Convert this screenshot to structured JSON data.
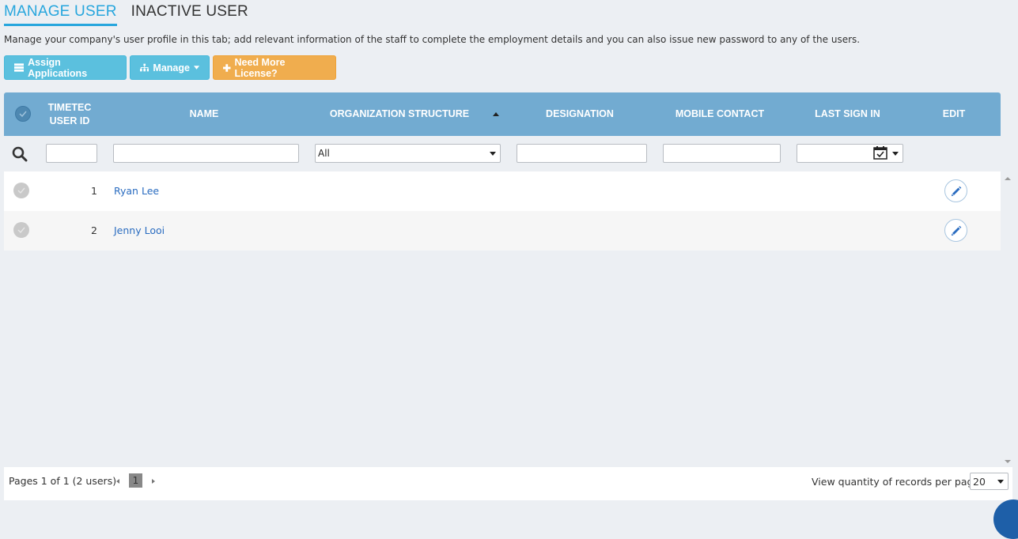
{
  "tabs": [
    {
      "label": "MANAGE USER",
      "active": true
    },
    {
      "label": "INACTIVE USER",
      "active": false
    }
  ],
  "description": "Manage your company's user profile in this tab; add relevant information of the staff to complete the employment details and you can also issue new password to any of the users.",
  "toolbar": {
    "assign_label": "Assign Applications",
    "manage_label": "Manage",
    "license_label": "Need More License?"
  },
  "columns": {
    "user_id": "TIMETEC USER ID",
    "name": "NAME",
    "org": "ORGANIZATION STRUCTURE",
    "designation": "DESIGNATION",
    "mobile": "MOBILE CONTACT",
    "last_sign_in": "LAST SIGN IN",
    "edit": "EDIT"
  },
  "filters": {
    "org_selected": "All"
  },
  "rows": [
    {
      "id": "1",
      "name": "Ryan Lee"
    },
    {
      "id": "2",
      "name": "Jenny Looi"
    }
  ],
  "pager": {
    "info": "Pages 1 of 1 (2 users)",
    "current_page": "1",
    "per_page_label": "View quantity of records per page",
    "per_page_value": "20"
  },
  "colors": {
    "header_bg": "#72abd1",
    "tab_active": "#27a6dd",
    "btn_info": "#5bc0de",
    "btn_warning": "#f0ad4e",
    "link": "#2a6cc0"
  }
}
